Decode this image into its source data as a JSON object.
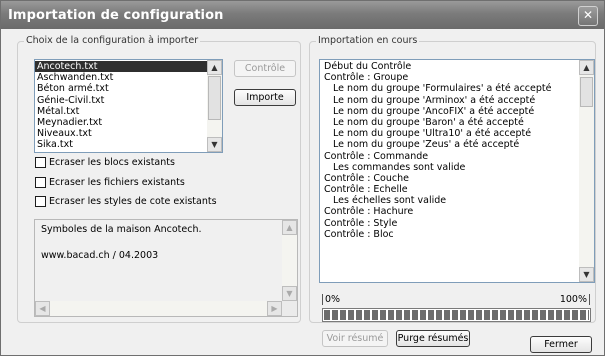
{
  "window": {
    "title": "Importation de configuration"
  },
  "choose": {
    "legend": "Choix de la configuration à importer",
    "files": [
      "Ancotech.txt",
      "Aschwanden.txt",
      "Béton armé.txt",
      "Génie-Civil.txt",
      "Métal.txt",
      "Meynadier.txt",
      "Niveaux.txt",
      "Sika.txt"
    ],
    "selected_index": 0
  },
  "buttons": {
    "controle": "Contrôle",
    "importe": "Importe",
    "voir": "Voir résumé",
    "purge": "Purge résumés",
    "fermer": "Fermer"
  },
  "options": [
    {
      "label": "Ecraser les blocs existants",
      "checked": false
    },
    {
      "label": "Ecraser les fichiers existants",
      "checked": false
    },
    {
      "label": "Ecraser les styles de cote existants",
      "checked": false
    }
  ],
  "description": {
    "line1": "Symboles de la maison Ancotech.",
    "line2": "www.bacad.ch / 04.2003"
  },
  "import": {
    "legend": "Importation en cours",
    "log": [
      "Début du Contrôle",
      "Contrôle : Groupe",
      "   Le nom du groupe 'Formulaires' a été accepté",
      "   Le nom du groupe 'Arminox' a été accepté",
      "   Le nom du groupe 'AncoFIX' a été accepté",
      "   Le nom du groupe 'Baron' a été accepté",
      "   Le nom du groupe 'Ultra10' a été accepté",
      "   Le nom du groupe 'Zeus' a été accepté",
      "Contrôle : Commande",
      "   Les commandes sont valide",
      "Contrôle : Couche",
      "Contrôle : Echelle",
      "   Les échelles sont valide",
      "Contrôle : Hachure",
      "Contrôle : Style",
      "Contrôle : Bloc"
    ],
    "progress": {
      "min_label": "0%",
      "max_label": "100%",
      "value_percent": 100
    }
  }
}
